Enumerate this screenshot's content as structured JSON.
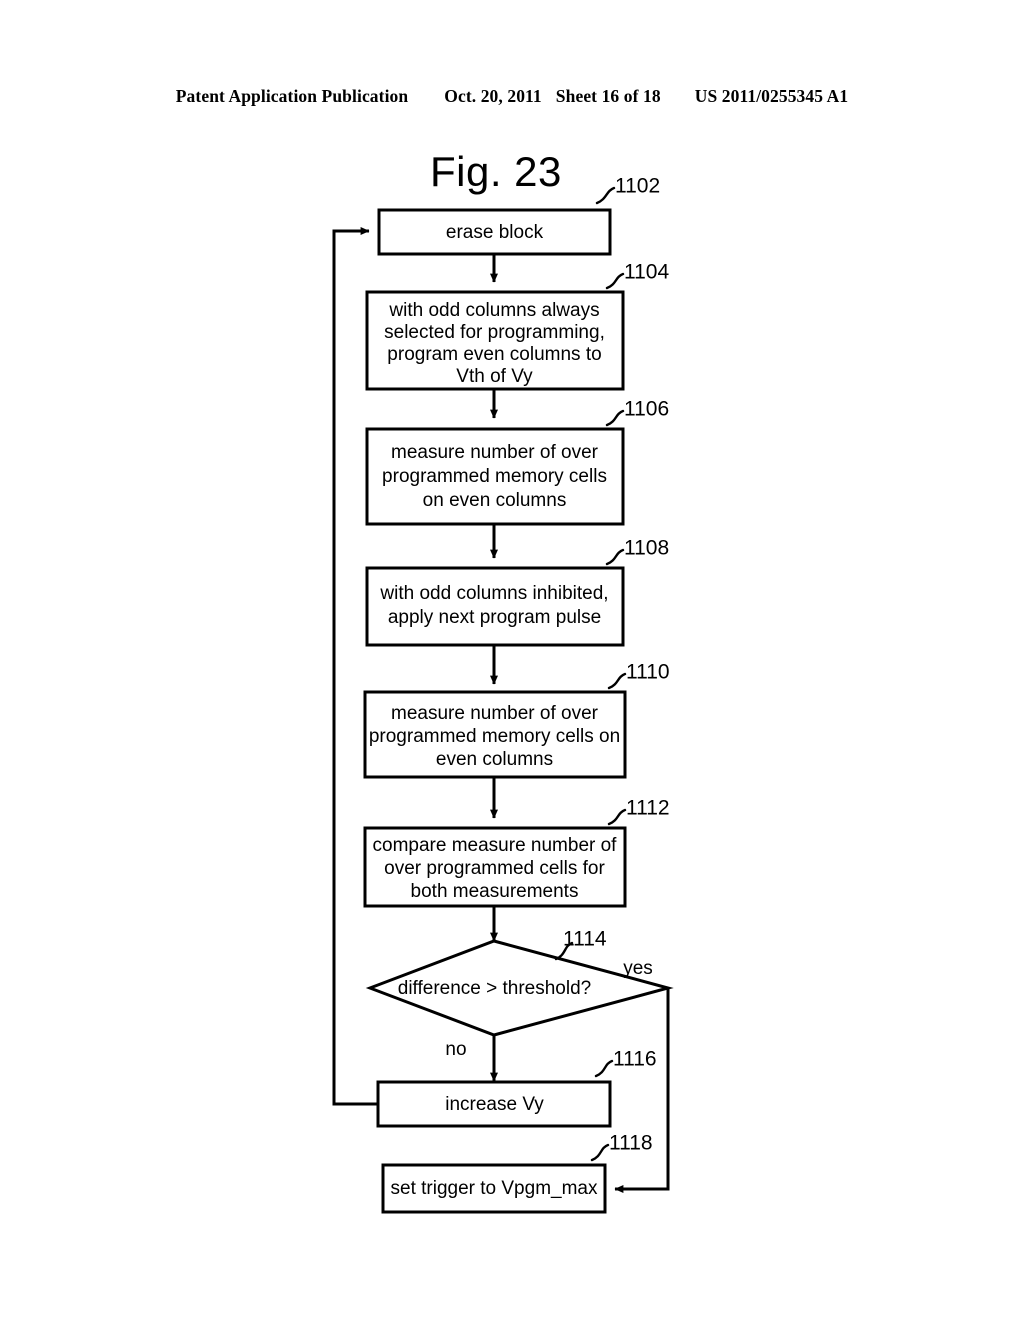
{
  "header": {
    "publication": "Patent Application Publication",
    "date": "Oct. 20, 2011",
    "sheet": "Sheet 16 of 18",
    "patent_number": "US 2011/0255345 A1"
  },
  "figure": {
    "title": "Fig. 23"
  },
  "flowchart": {
    "nodes": [
      {
        "id": "1102",
        "ref": "1102",
        "shape": "process",
        "lines": [
          "erase block"
        ]
      },
      {
        "id": "1104",
        "ref": "1104",
        "shape": "process",
        "lines": [
          "with odd columns always",
          "selected for programming,",
          "program even columns to",
          "Vth of Vy"
        ]
      },
      {
        "id": "1106",
        "ref": "1106",
        "shape": "process",
        "lines": [
          "measure number of over",
          "programmed memory cells",
          "on even columns"
        ]
      },
      {
        "id": "1108",
        "ref": "1108",
        "shape": "process",
        "lines": [
          "with odd columns inhibited,",
          "apply next program pulse"
        ]
      },
      {
        "id": "1110",
        "ref": "1110",
        "shape": "process",
        "lines": [
          "measure number of over",
          "programmed memory cells on",
          "even columns"
        ]
      },
      {
        "id": "1112",
        "ref": "1112",
        "shape": "process",
        "lines": [
          "compare measure number of",
          "over programmed cells for",
          "both measurements"
        ]
      },
      {
        "id": "1114",
        "ref": "1114",
        "shape": "decision",
        "lines": [
          "difference > threshold?"
        ]
      },
      {
        "id": "1116",
        "ref": "1116",
        "shape": "process",
        "lines": [
          "increase Vy"
        ]
      },
      {
        "id": "1118",
        "ref": "1118",
        "shape": "process",
        "lines": [
          "set trigger to Vpgm_max"
        ]
      }
    ],
    "branch_labels": {
      "yes": "yes",
      "no": "no"
    }
  }
}
